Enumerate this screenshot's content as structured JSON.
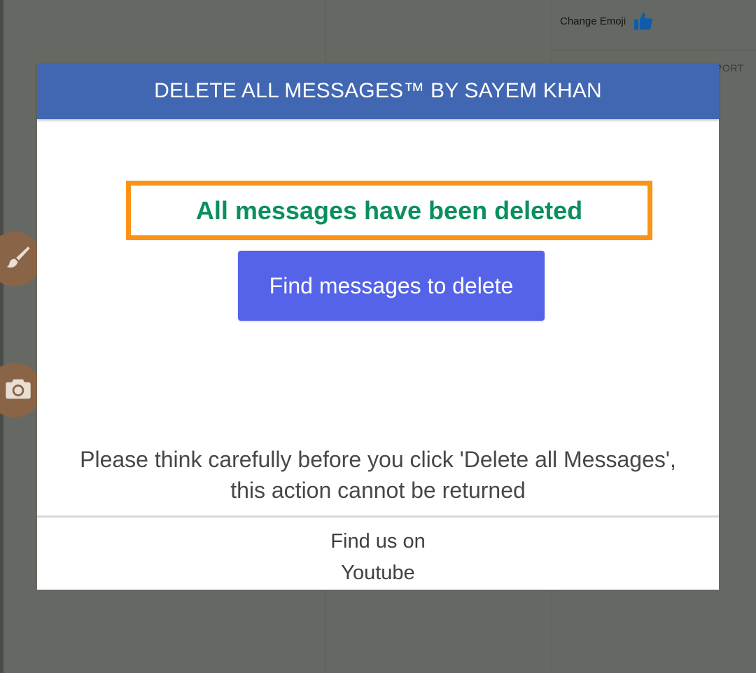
{
  "background": {
    "change_emoji_label": "Change Emoji",
    "report_fragment": "PORT",
    "thumb_icon": "thumbs-up-icon",
    "brush_icon": "paint-brush-icon",
    "camera_icon": "camera-icon"
  },
  "modal": {
    "title": "DELETE ALL MESSAGES™ BY SAYEM KHAN",
    "status_message": "All messages have been deleted",
    "find_button_label": "Find messages to delete",
    "warning": "Please think carefully before you click 'Delete all Messages', this action cannot be returned",
    "footer_prefix": "Find us on",
    "footer_link": "Youtube"
  },
  "colors": {
    "header": "#4267b2",
    "status_text": "#0b8f5c",
    "highlight_border": "#fa9419",
    "button": "#5463e8",
    "overlay": "#666864"
  }
}
